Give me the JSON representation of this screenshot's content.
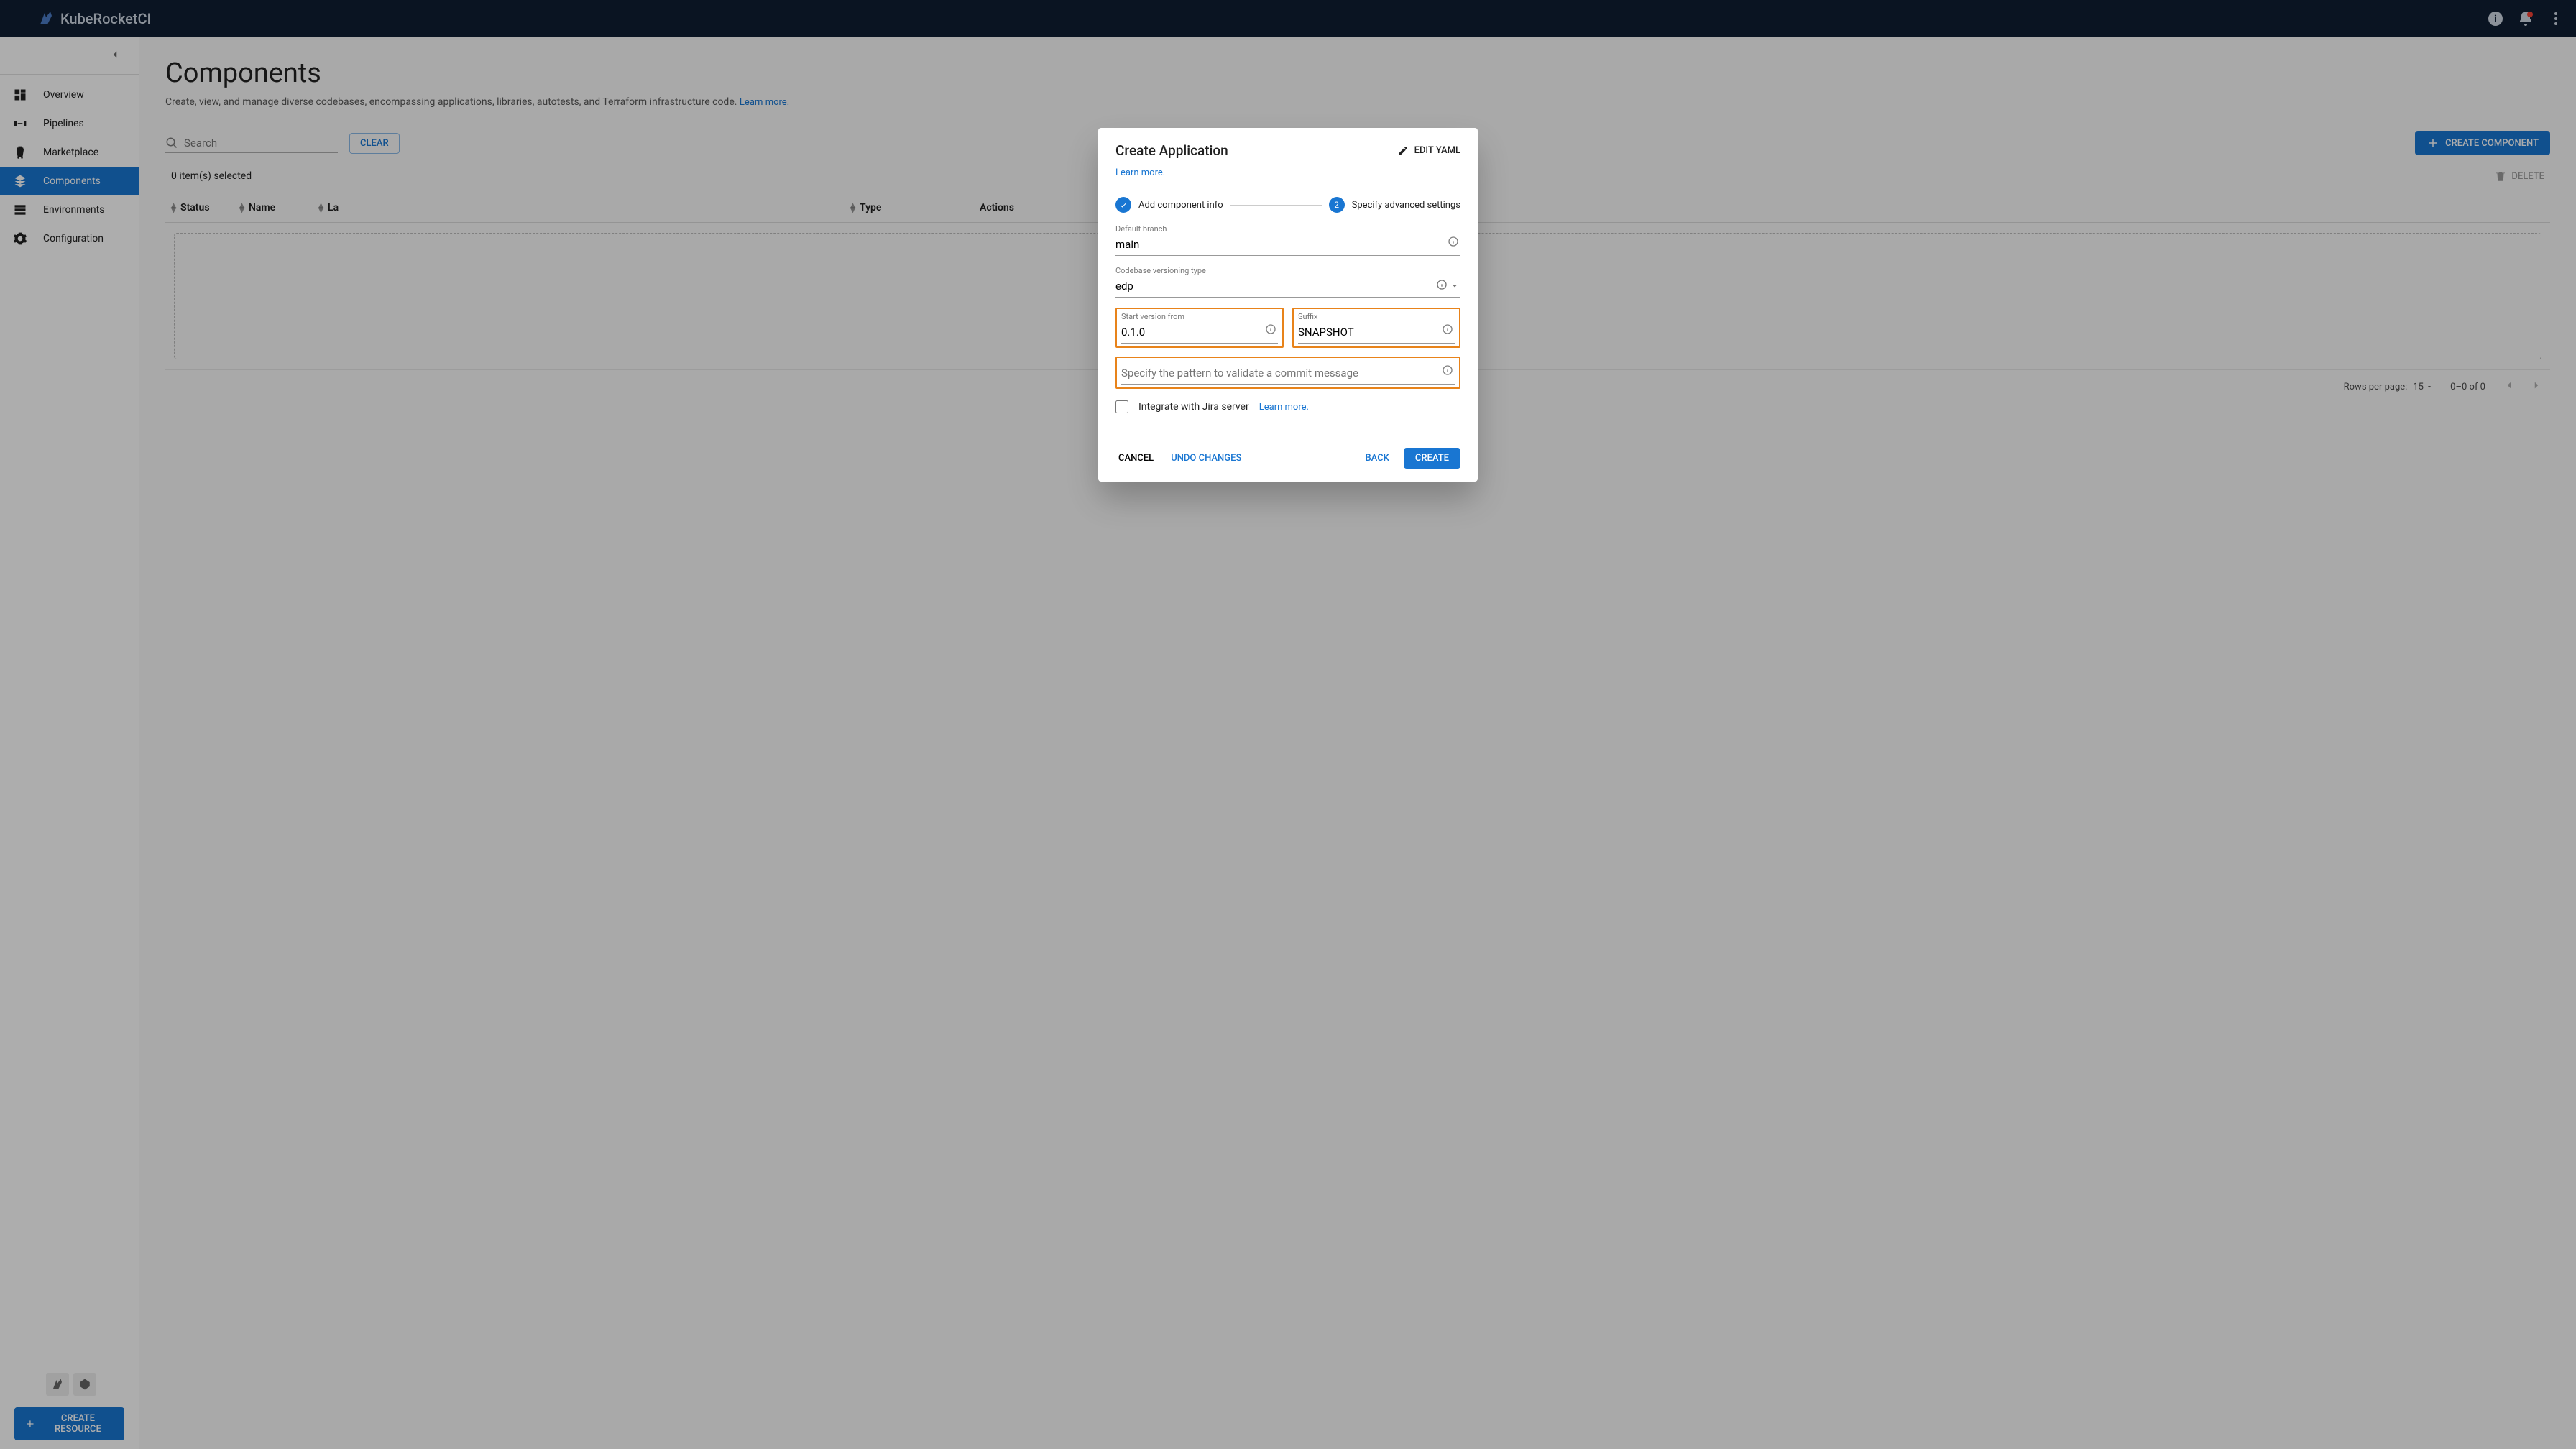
{
  "brand": "KubeRocketCI",
  "sidebar": {
    "items": [
      {
        "label": "Overview"
      },
      {
        "label": "Pipelines"
      },
      {
        "label": "Marketplace"
      },
      {
        "label": "Components"
      },
      {
        "label": "Environments"
      },
      {
        "label": "Configuration"
      }
    ],
    "create_resource": "CREATE RESOURCE"
  },
  "page": {
    "title": "Components",
    "description": "Create, view, and manage diverse codebases, encompassing applications, libraries, autotests, and Terraform infrastructure code.",
    "learn_more": "Learn more."
  },
  "toolbar": {
    "search_placeholder": "Search",
    "clear": "CLEAR",
    "create_component": "CREATE COMPONENT"
  },
  "table": {
    "selected_text": "0 item(s) selected",
    "delete": "DELETE",
    "cols": {
      "status": "Status",
      "name": "Name",
      "lang": "La",
      "type": "Type",
      "actions": "Actions"
    },
    "rows_per_page_label": "Rows per page:",
    "rows_per_page_value": "15",
    "range": "0–0 of 0"
  },
  "dialog": {
    "title": "Create Application",
    "edit_yaml": "EDIT YAML",
    "learn_more": "Learn more.",
    "step1": "Add component info",
    "step2": "Specify advanced settings",
    "step2_num": "2",
    "fields": {
      "default_branch_label": "Default branch",
      "default_branch_value": "main",
      "versioning_label": "Codebase versioning type",
      "versioning_value": "edp",
      "start_version_label": "Start version from",
      "start_version_value": "0.1.0",
      "suffix_label": "Suffix",
      "suffix_value": "SNAPSHOT",
      "commit_pattern_placeholder": "Specify the pattern to validate a commit message",
      "jira_label": "Integrate with Jira server",
      "jira_learn": "Learn more."
    },
    "buttons": {
      "cancel": "CANCEL",
      "undo": "UNDO CHANGES",
      "back": "BACK",
      "create": "CREATE"
    }
  }
}
